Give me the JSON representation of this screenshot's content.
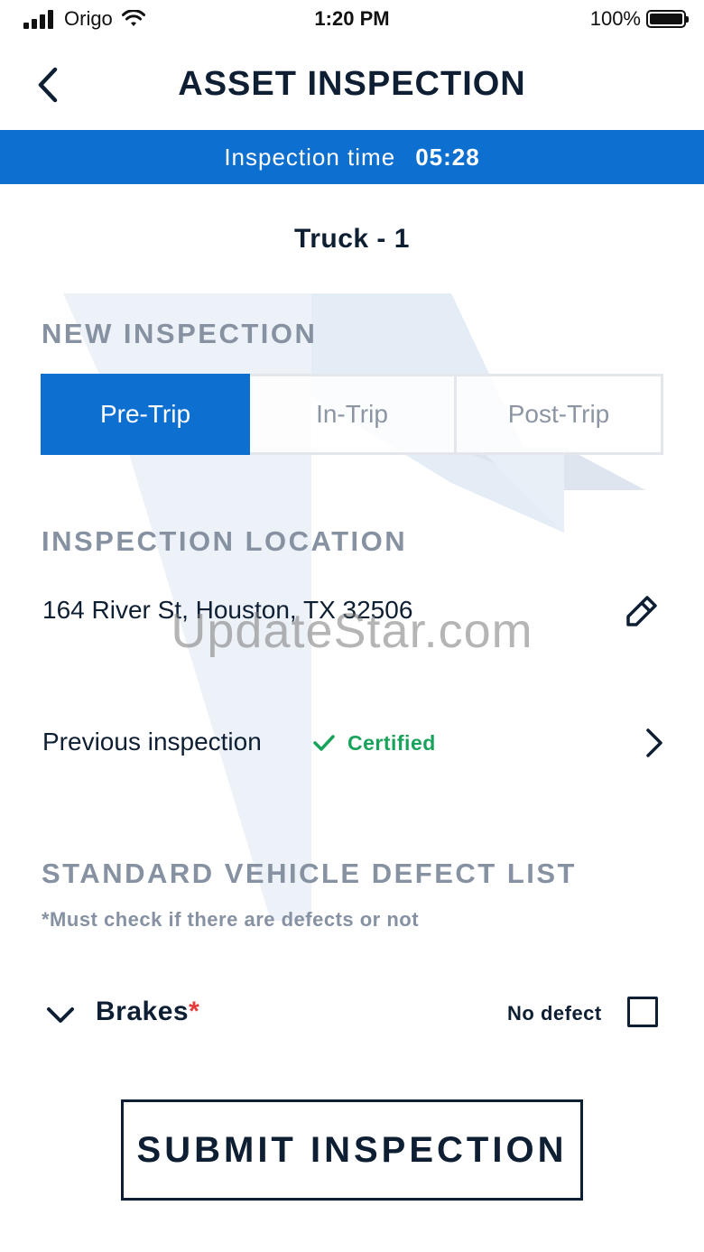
{
  "status_bar": {
    "carrier": "Origo",
    "time": "1:20 PM",
    "battery": "100%"
  },
  "header": {
    "title": "ASSET INSPECTION",
    "back_icon": "chevron-left-icon"
  },
  "timer": {
    "label": "Inspection time",
    "value": "05:28"
  },
  "asset": {
    "name": "Truck - 1"
  },
  "new_inspection": {
    "heading": "NEW INSPECTION",
    "options": [
      {
        "label": "Pre-Trip",
        "selected": true
      },
      {
        "label": "In-Trip",
        "selected": false
      },
      {
        "label": "Post-Trip",
        "selected": false
      }
    ]
  },
  "location": {
    "heading": "INSPECTION LOCATION",
    "address": "164 River St, Houston, TX 32506",
    "edit_icon": "pencil-icon"
  },
  "previous": {
    "label": "Previous inspection",
    "status": "Certified",
    "status_icon": "check-icon",
    "status_color": "#18a35a"
  },
  "defects": {
    "heading": "STANDARD VEHICLE DEFECT LIST",
    "note": "*Must check if there are defects or not",
    "items": [
      {
        "label": "Brakes",
        "required_mark": "*",
        "checkbox_label": "No defect",
        "checked": false
      }
    ]
  },
  "submit": {
    "label": "SUBMIT INSPECTION"
  },
  "watermark": "UpdateStar.com",
  "colors": {
    "accent": "#0d6fd0",
    "text": "#0f1f33",
    "muted": "#8691a1",
    "success": "#18a35a",
    "required": "#e53a3a"
  }
}
